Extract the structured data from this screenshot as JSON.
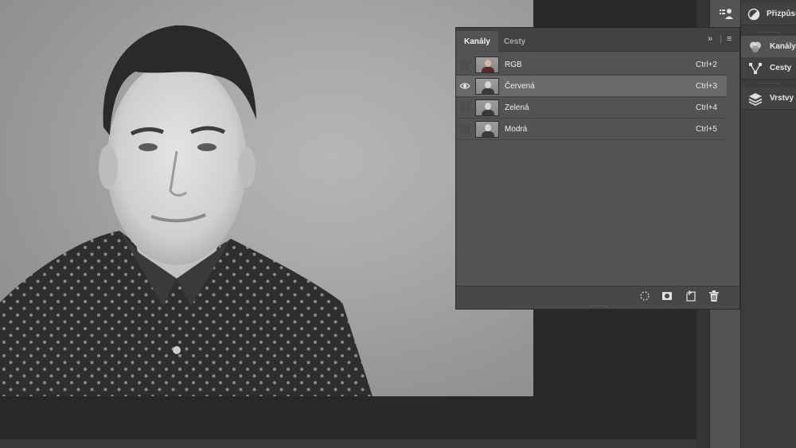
{
  "app": "Adobe Photoshop",
  "channels_panel": {
    "tabs": [
      {
        "label": "Kanály",
        "active": true
      },
      {
        "label": "Cesty",
        "active": false
      }
    ],
    "expand_glyph": "»",
    "menu_glyph": "≡",
    "channels": [
      {
        "name": "RGB",
        "shortcut": "Ctrl+2",
        "visible": false,
        "selected": false
      },
      {
        "name": "Červená",
        "shortcut": "Ctrl+3",
        "visible": true,
        "selected": true
      },
      {
        "name": "Zelená",
        "shortcut": "Ctrl+4",
        "visible": false,
        "selected": false
      },
      {
        "name": "Modrá",
        "shortcut": "Ctrl+5",
        "visible": false,
        "selected": false
      }
    ],
    "bottom_buttons": [
      "load-selection-icon",
      "save-selection-icon",
      "new-channel-icon",
      "trash-icon"
    ]
  },
  "dock": {
    "items": [
      {
        "label": "Přizpůso",
        "icon": "adjustments-icon"
      },
      {
        "label": "Kanály",
        "icon": "channels-icon"
      },
      {
        "label": "Cesty",
        "icon": "paths-icon"
      },
      {
        "label": "Vrstvy",
        "icon": "layers-icon"
      }
    ]
  },
  "toolbar_icon": "clone-source-icon",
  "colors": {
    "panel_bg": "#535353",
    "selected_row": "#6a6a6a",
    "canvas_bg": "#282828"
  }
}
